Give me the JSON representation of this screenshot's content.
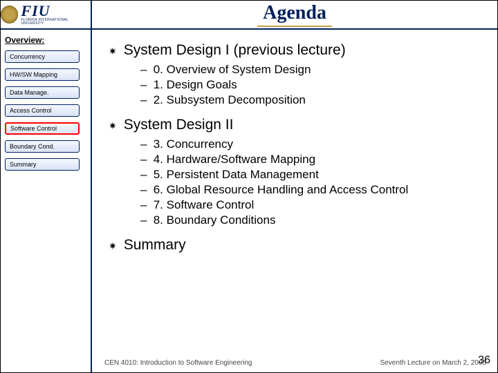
{
  "logo": {
    "main": "FIU",
    "sub": "FLORIDA INTERNATIONAL UNIVERSITY"
  },
  "title": "Agenda",
  "sidebar": {
    "heading": "Overview:",
    "items": [
      {
        "label": "Concurrency",
        "active": false
      },
      {
        "label": "HW/SW Mapping",
        "active": false
      },
      {
        "label": "Data Manage.",
        "active": false
      },
      {
        "label": "Access Control",
        "active": false
      },
      {
        "label": "Software Control",
        "active": true
      },
      {
        "label": "Boundary Cond.",
        "active": false
      },
      {
        "label": "Summary",
        "active": false
      }
    ]
  },
  "agenda": [
    {
      "heading": "System Design I (previous lecture)",
      "items": [
        "0. Overview of System Design",
        "1. Design Goals",
        "2. Subsystem Decomposition"
      ]
    },
    {
      "heading": "System Design II",
      "items": [
        "3. Concurrency",
        "4. Hardware/Software Mapping",
        "5. Persistent Data Management",
        "6. Global Resource Handling and Access Control",
        "7. Software Control",
        "8. Boundary Conditions"
      ]
    },
    {
      "heading": "Summary",
      "items": []
    }
  ],
  "footer": {
    "left": "CEN 4010: Introduction to Software Engineering",
    "right": "Seventh Lecture on March 2, 2005"
  },
  "page_number": "36"
}
